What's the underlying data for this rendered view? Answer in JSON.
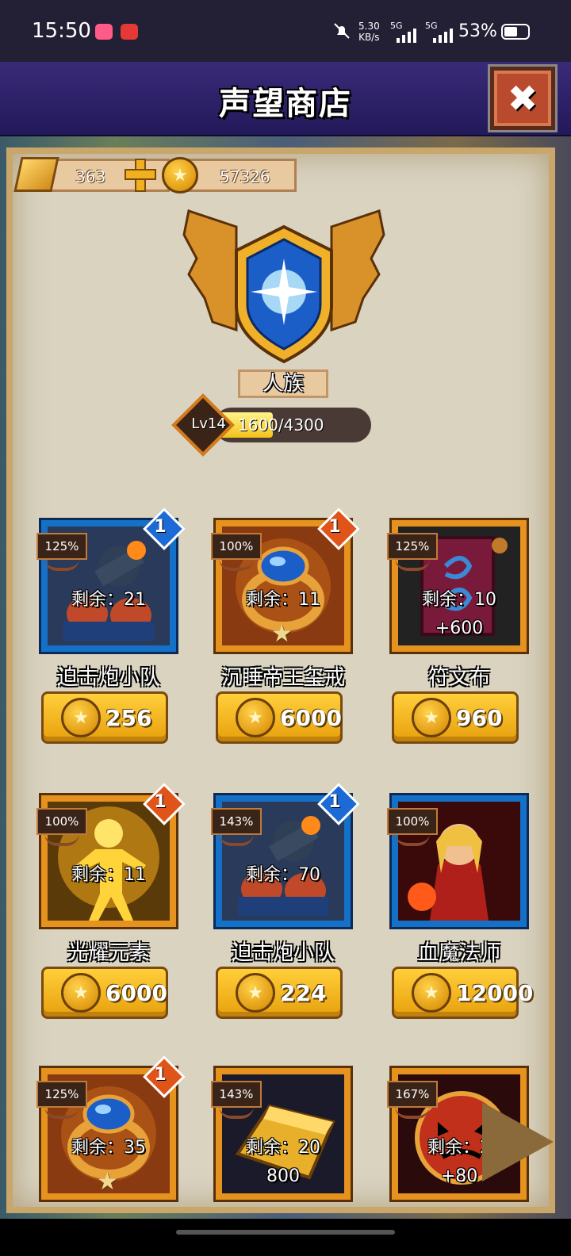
{
  "status_bar": {
    "time": "15:50",
    "net_speed_value": "5.30",
    "net_speed_unit": "KB/s",
    "sig1": "5G",
    "sig2": "5G",
    "battery": "53%"
  },
  "header": {
    "title": "声望商店"
  },
  "currency": {
    "gold": "363",
    "coins": "57326"
  },
  "faction": {
    "name": "人族",
    "level_label": "Lv14",
    "xp_text": "1600/4300",
    "xp_fraction": 0.372
  },
  "items": [
    {
      "name": "迫击炮小队",
      "remaining": "剩余：21",
      "percent": "125%",
      "badge": "1",
      "badge_color": "blue",
      "frame": "blue",
      "price": "256",
      "bonus": "",
      "art": "cannon"
    },
    {
      "name": "沉睡帝王玺戒",
      "remaining": "剩余：11",
      "percent": "100%",
      "badge": "1",
      "badge_color": "orange",
      "frame": "orange",
      "price": "6000",
      "bonus": "",
      "art": "ring"
    },
    {
      "name": "符文布",
      "remaining": "剩余：10",
      "percent": "125%",
      "badge": "",
      "badge_color": "",
      "frame": "orange",
      "price": "960",
      "bonus": "+600",
      "art": "cloth"
    },
    {
      "name": "光耀元素",
      "remaining": "剩余：11",
      "percent": "100%",
      "badge": "1",
      "badge_color": "orange",
      "frame": "orange",
      "price": "6000",
      "bonus": "",
      "art": "light"
    },
    {
      "name": "迫击炮小队",
      "remaining": "剩余：70",
      "percent": "143%",
      "badge": "1",
      "badge_color": "blue",
      "frame": "blue",
      "price": "224",
      "bonus": "",
      "art": "cannon"
    },
    {
      "name": "血魔法师",
      "remaining": "",
      "percent": "100%",
      "badge": "",
      "badge_color": "",
      "frame": "blue",
      "price": "12000",
      "bonus": "",
      "art": "mage"
    },
    {
      "name": "",
      "remaining": "剩余：35",
      "percent": "125%",
      "badge": "1",
      "badge_color": "orange",
      "frame": "orange",
      "price": "",
      "bonus": "",
      "art": "ring"
    },
    {
      "name": "",
      "remaining": "剩余：20",
      "percent": "143%",
      "badge": "",
      "badge_color": "",
      "frame": "orange",
      "price": "",
      "bonus": "800",
      "art": "goldbar"
    },
    {
      "name": "",
      "remaining": "剩余：2",
      "percent": "167%",
      "badge": "",
      "badge_color": "",
      "frame": "orange",
      "price": "",
      "bonus": "+80",
      "art": "demon"
    }
  ],
  "colors": {
    "accent_gold": "#f3c21a",
    "frame_blue": "#1570c8",
    "frame_orange": "#e6921e",
    "header": "#3a2a78"
  }
}
